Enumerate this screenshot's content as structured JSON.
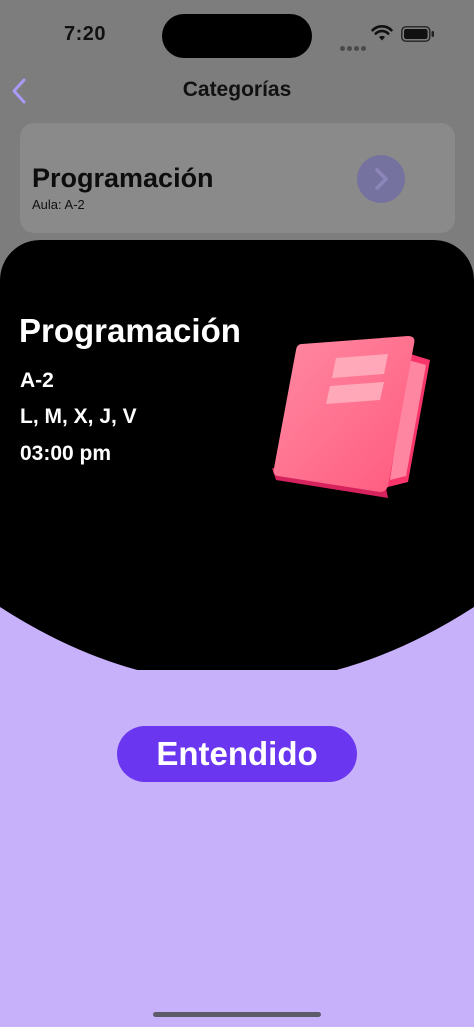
{
  "status_bar": {
    "time": "7:20",
    "icons": [
      "signal-icon",
      "wifi-icon",
      "battery-icon"
    ]
  },
  "nav": {
    "title": "Categorías",
    "back_icon": "chevron-left-icon"
  },
  "category_card": {
    "name": "Programación",
    "room": "Aula: A-2",
    "action_icon": "chevron-right-icon"
  },
  "detail_sheet": {
    "title": "Programación",
    "room": "A-2",
    "days": "L, M, X, J, V",
    "time": "03:00 pm",
    "illustration": "book-icon",
    "confirm_label": "Entendido"
  },
  "colors": {
    "dim_background": "#7d7d7d",
    "sheet_lavender": "#c8b1fb",
    "sheet_dark": "#000000",
    "accent_purple": "#6a36f0",
    "book_pink": "#ff6f8a",
    "back_chevron": "#a99af7"
  }
}
